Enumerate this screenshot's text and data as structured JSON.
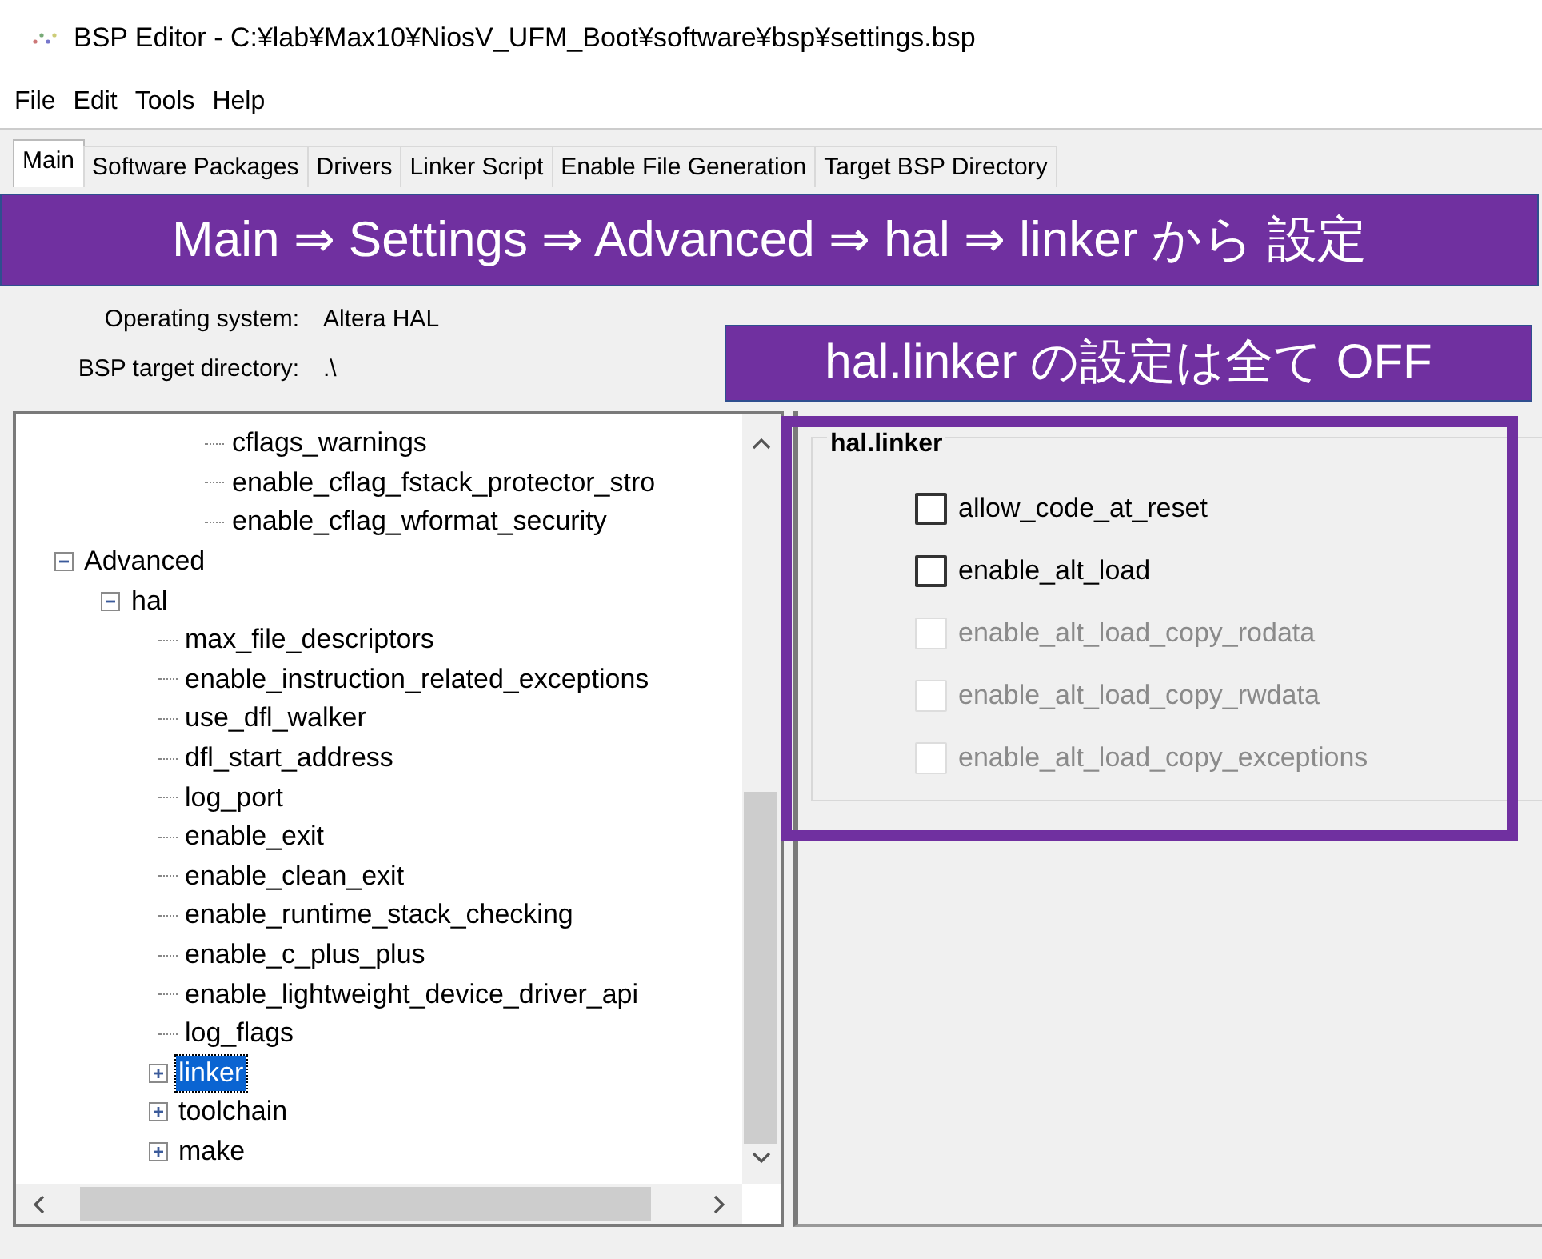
{
  "window": {
    "title": "BSP Editor - C:¥lab¥Max10¥NiosV_UFM_Boot¥software¥bsp¥settings.bsp"
  },
  "menu": [
    "File",
    "Edit",
    "Tools",
    "Help"
  ],
  "tabs": [
    {
      "label": "Main",
      "selected": true
    },
    {
      "label": "Software Packages",
      "selected": false
    },
    {
      "label": "Drivers",
      "selected": false
    },
    {
      "label": "Linker Script",
      "selected": false
    },
    {
      "label": "Enable File Generation",
      "selected": false
    },
    {
      "label": "Target BSP Directory",
      "selected": false
    }
  ],
  "info": [
    {
      "label": "Operating system:",
      "value": "Altera HAL"
    },
    {
      "label": "BSP target directory:",
      "value": ".\\"
    }
  ],
  "tree": [
    {
      "children": [
        {
          "children": [
            {
              "children": [
                {
                  "label": "cflags_warnings",
                  "selected": false
                },
                {
                  "label": "enable_cflag_fstack_protector_stro",
                  "selected": false
                },
                {
                  "label": "enable_cflag_wformat_security",
                  "selected": false
                }
              ]
            }
          ]
        }
      ]
    },
    {
      "label": "Advanced",
      "expanded": true,
      "selected": false,
      "children": [
        {
          "label": "hal",
          "expanded": true,
          "selected": false,
          "children": [
            {
              "label": "max_file_descriptors",
              "selected": false
            },
            {
              "label": "enable_instruction_related_exceptions",
              "selected": false
            },
            {
              "label": "use_dfl_walker",
              "selected": false
            },
            {
              "label": "dfl_start_address",
              "selected": false
            },
            {
              "label": "log_port",
              "selected": false
            },
            {
              "label": "enable_exit",
              "selected": false
            },
            {
              "label": "enable_clean_exit",
              "selected": false
            },
            {
              "label": "enable_runtime_stack_checking",
              "selected": false
            },
            {
              "label": "enable_c_plus_plus",
              "selected": false
            },
            {
              "label": "enable_lightweight_device_driver_api",
              "selected": false
            },
            {
              "label": "log_flags",
              "selected": false
            },
            {
              "label": "linker",
              "expanded": false,
              "selected": true
            },
            {
              "label": "toolchain",
              "expanded": false,
              "selected": false
            },
            {
              "label": "make",
              "expanded": false,
              "selected": false
            }
          ]
        }
      ]
    }
  ],
  "group": {
    "title": "hal.linker",
    "options": [
      {
        "label": "allow_code_at_reset",
        "checked": false,
        "disabled": false
      },
      {
        "label": "enable_alt_load",
        "checked": false,
        "disabled": false
      },
      {
        "label": "enable_alt_load_copy_rodata",
        "checked": false,
        "disabled": true
      },
      {
        "label": "enable_alt_load_copy_rwdata",
        "checked": false,
        "disabled": true
      },
      {
        "label": "enable_alt_load_copy_exceptions",
        "checked": false,
        "disabled": true
      }
    ]
  },
  "annotations": [
    {
      "text": "Main ⇒ Settings ⇒ Advanced ⇒ hal ⇒ linker から 設定"
    },
    {
      "text": "hal.linker の設定は全て OFF"
    }
  ]
}
